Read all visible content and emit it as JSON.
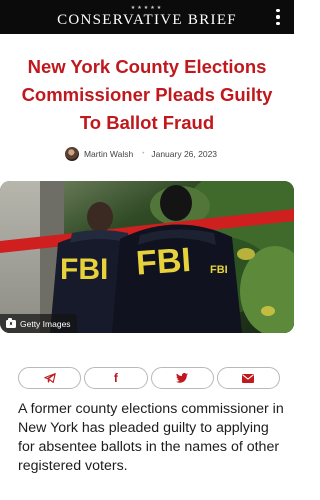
{
  "header": {
    "stars": "★★★★★",
    "brand": "CONSERVATIVE BRIEF",
    "background": "#0b0b0b"
  },
  "article": {
    "headline": "New York County Elections Commissioner Pleads Guilty To Ballot Fraud",
    "author": "Martin Walsh",
    "separator": "•",
    "date": "January 26, 2023",
    "hero_vest_text": "FBI",
    "photo_credit": "Getty Images",
    "paragraph": "A former county elections commissioner in New York has pleaded guilty to applying for absentee ballots in the names of other registered voters."
  },
  "share": [
    {
      "network": "telegram",
      "icon": "paper-plane-icon"
    },
    {
      "network": "facebook",
      "icon": "facebook-icon",
      "glyph": "f"
    },
    {
      "network": "twitter",
      "icon": "twitter-bird-icon"
    },
    {
      "network": "email",
      "icon": "envelope-icon"
    }
  ],
  "colors": {
    "accent": "#c0181d",
    "text": "#1d1d1d",
    "meta": "#444444"
  }
}
